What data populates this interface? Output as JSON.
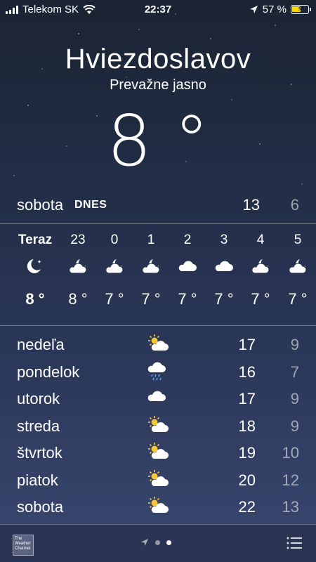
{
  "status_bar": {
    "carrier": "Telekom SK",
    "time": "22:37",
    "battery_percent": "57 %",
    "battery_level": 0.57,
    "battery_color": "#f5d90a"
  },
  "location": {
    "city": "Hviezdoslavov",
    "condition": "Prevažne jasno",
    "temperature": "8 °"
  },
  "today": {
    "day": "sobota",
    "badge": "DNES",
    "high": "13",
    "low": "6"
  },
  "hourly": [
    {
      "label": "Teraz",
      "icon": "moon-stars-icon",
      "temp": "8 °"
    },
    {
      "label": "23",
      "icon": "partly-cloudy-night-icon",
      "temp": "8 °"
    },
    {
      "label": "0",
      "icon": "partly-cloudy-night-icon",
      "temp": "7 °"
    },
    {
      "label": "1",
      "icon": "partly-cloudy-night-icon",
      "temp": "7 °"
    },
    {
      "label": "2",
      "icon": "cloud-icon",
      "temp": "7 °"
    },
    {
      "label": "3",
      "icon": "cloud-icon",
      "temp": "7 °"
    },
    {
      "label": "4",
      "icon": "partly-cloudy-night-icon",
      "temp": "7 °"
    },
    {
      "label": "5",
      "icon": "partly-cloudy-night-icon",
      "temp": "7 °"
    }
  ],
  "daily": [
    {
      "day": "nedeľa",
      "icon": "partly-sunny-icon",
      "high": "17",
      "low": "9"
    },
    {
      "day": "pondelok",
      "icon": "rain-cloud-icon",
      "high": "16",
      "low": "7"
    },
    {
      "day": "utorok",
      "icon": "cloud-icon",
      "high": "17",
      "low": "9"
    },
    {
      "day": "streda",
      "icon": "partly-sunny-icon",
      "high": "18",
      "low": "9"
    },
    {
      "day": "štvrtok",
      "icon": "partly-sunny-icon",
      "high": "19",
      "low": "10"
    },
    {
      "day": "piatok",
      "icon": "partly-sunny-icon",
      "high": "20",
      "low": "12"
    },
    {
      "day": "sobota",
      "icon": "partly-sunny-icon",
      "high": "22",
      "low": "13"
    }
  ],
  "bottom_bar": {
    "logo_text": "The Weather Channel",
    "active_page": 2
  }
}
